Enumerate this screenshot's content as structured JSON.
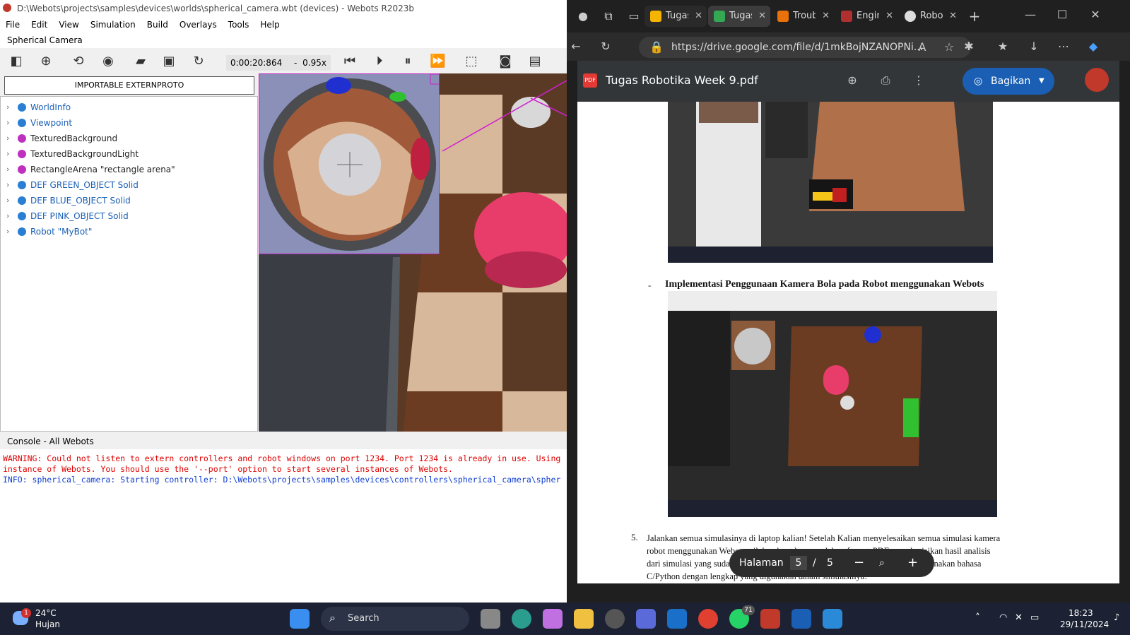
{
  "webots": {
    "title": "D:\\Webots\\projects\\samples\\devices\\worlds\\spherical_camera.wbt (devices) - Webots R2023b",
    "menu": [
      "File",
      "Edit",
      "View",
      "Simulation",
      "Build",
      "Overlays",
      "Tools",
      "Help"
    ],
    "scene_label": "Spherical Camera",
    "time": "0:00:20:864",
    "time_sep": "-",
    "speed": "0.95x",
    "proto_button": "IMPORTABLE EXTERNPROTO",
    "tree": [
      {
        "label": "WorldInfo",
        "color": "#2a7fd4",
        "text_color": "#1a5fb4"
      },
      {
        "label": "Viewpoint",
        "color": "#2a7fd4",
        "text_color": "#1a5fb4"
      },
      {
        "label": "TexturedBackground",
        "color": "#c030c0",
        "text_color": "#222"
      },
      {
        "label": "TexturedBackgroundLight",
        "color": "#c030c0",
        "text_color": "#222"
      },
      {
        "label": "RectangleArena \"rectangle arena\"",
        "color": "#c030c0",
        "text_color": "#222"
      },
      {
        "label": "DEF GREEN_OBJECT Solid",
        "color": "#2a7fd4",
        "text_color": "#1a5fb4"
      },
      {
        "label": "DEF BLUE_OBJECT Solid",
        "color": "#2a7fd4",
        "text_color": "#1a5fb4"
      },
      {
        "label": "DEF PINK_OBJECT Solid",
        "color": "#2a7fd4",
        "text_color": "#1a5fb4"
      },
      {
        "label": "Robot \"MyBot\"",
        "color": "#2a7fd4",
        "text_color": "#1a5fb4"
      }
    ],
    "console_title": "Console - All Webots",
    "console": {
      "warning1": "WARNING: Could not listen to extern controllers and robot windows on port 1234. Port 1234 is already in use. Using",
      "warning2": "instance of Webots. You should use the '--port' option to start several instances of Webots.",
      "info": "INFO: spherical_camera: Starting controller: D:\\Webots\\projects\\samples\\devices\\controllers\\spherical_camera\\spher"
    }
  },
  "edge": {
    "tabs": [
      {
        "label": "Tugas",
        "color": "#f4b400"
      },
      {
        "label": "Tugas",
        "color": "#34a853"
      },
      {
        "label": "Troub",
        "color": "#e8710a"
      },
      {
        "label": "Engin",
        "color": "#b03030"
      },
      {
        "label": "Robo",
        "color": "#dddddd"
      }
    ],
    "url": "https://drive.google.com/file/d/1mkBojNZANOPNi...",
    "pdf_title": "Tugas Robotika Week 9.pdf",
    "share_label": "Bagikan",
    "bullet_dash": "-",
    "heading": "Implementasi Penggunaan Kamera Bola pada Robot menggunakan Webots",
    "item_number": "5.",
    "paragraph_lines": [
      "Jalankan semua simulasinya di laptop kalian! Setelah Kalian menyelesaikan semua simulasi kamera",
      "robot menggunakan Webots, silakan buat laporan dalam format PDF yang berisikan hasil analisis",
      "dari simulasi yang sudah dilakukan juga beserta penjelasan kodingannya menggunakan bahasa",
      "C/Python dengan lengkap yang digunakan dalam simulasinya!"
    ],
    "page_nav": {
      "label": "Halaman",
      "current": "5",
      "sep": "/",
      "total": "5"
    }
  },
  "taskbar": {
    "weather_temp": "24°C",
    "weather_desc": "Hujan",
    "weather_badge": "1",
    "search_label": "Search",
    "whatsapp_badge": "71",
    "time": "18:23",
    "date": "29/11/2024"
  }
}
